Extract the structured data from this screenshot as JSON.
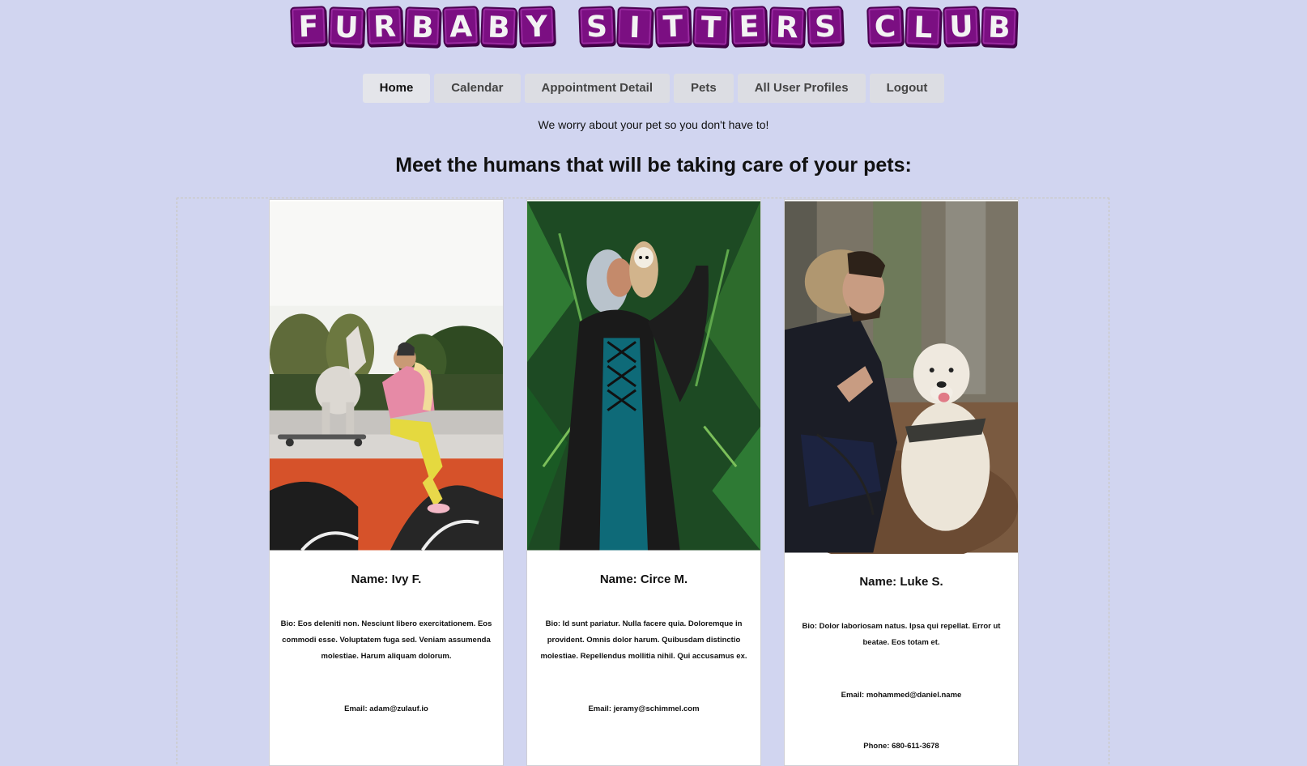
{
  "logo": {
    "words": [
      [
        "F",
        "U",
        "R",
        "B",
        "A",
        "B",
        "Y"
      ],
      [
        "S",
        "I",
        "T",
        "T",
        "E",
        "R",
        "S"
      ],
      [
        "C",
        "L",
        "U",
        "B"
      ]
    ]
  },
  "nav": {
    "items": [
      {
        "label": "Home",
        "active": true
      },
      {
        "label": "Calendar",
        "active": false
      },
      {
        "label": "Appointment Detail",
        "active": false
      },
      {
        "label": "Pets",
        "active": false
      },
      {
        "label": "All User Profiles",
        "active": false
      },
      {
        "label": "Logout",
        "active": false
      }
    ]
  },
  "tagline": "We worry about your pet so you don't have to!",
  "heading": "Meet the humans that will be taking care of your pets:",
  "sitters": [
    {
      "name": "Name: Ivy F.",
      "bio": "Bio: Eos deleniti non. Nesciunt libero exercitationem. Eos commodi esse. Voluptatem fuga sed. Veniam assumenda molestiae. Harum aliquam dolorum.",
      "email": "Email: adam@zulauf.io"
    },
    {
      "name": "Name: Circe M.",
      "bio": "Bio: Id sunt pariatur. Nulla facere quia. Doloremque in provident. Omnis dolor harum. Quibusdam distinctio molestiae. Repellendus mollitia nihil. Qui accusamus ex.",
      "email": "Email: jeramy@schimmel.com"
    },
    {
      "name": "Name: Luke S.",
      "bio": "Bio: Dolor laboriosam natus. Ipsa qui repellat. Error ut beatae. Eos totam et.",
      "email": "Email: mohammed@daniel.name",
      "phone": "Phone: 680-611-3678"
    }
  ],
  "colors": {
    "background": "#d1d5f0",
    "logo_tile": "#7b0f82",
    "nav_button": "#dcdde3"
  }
}
